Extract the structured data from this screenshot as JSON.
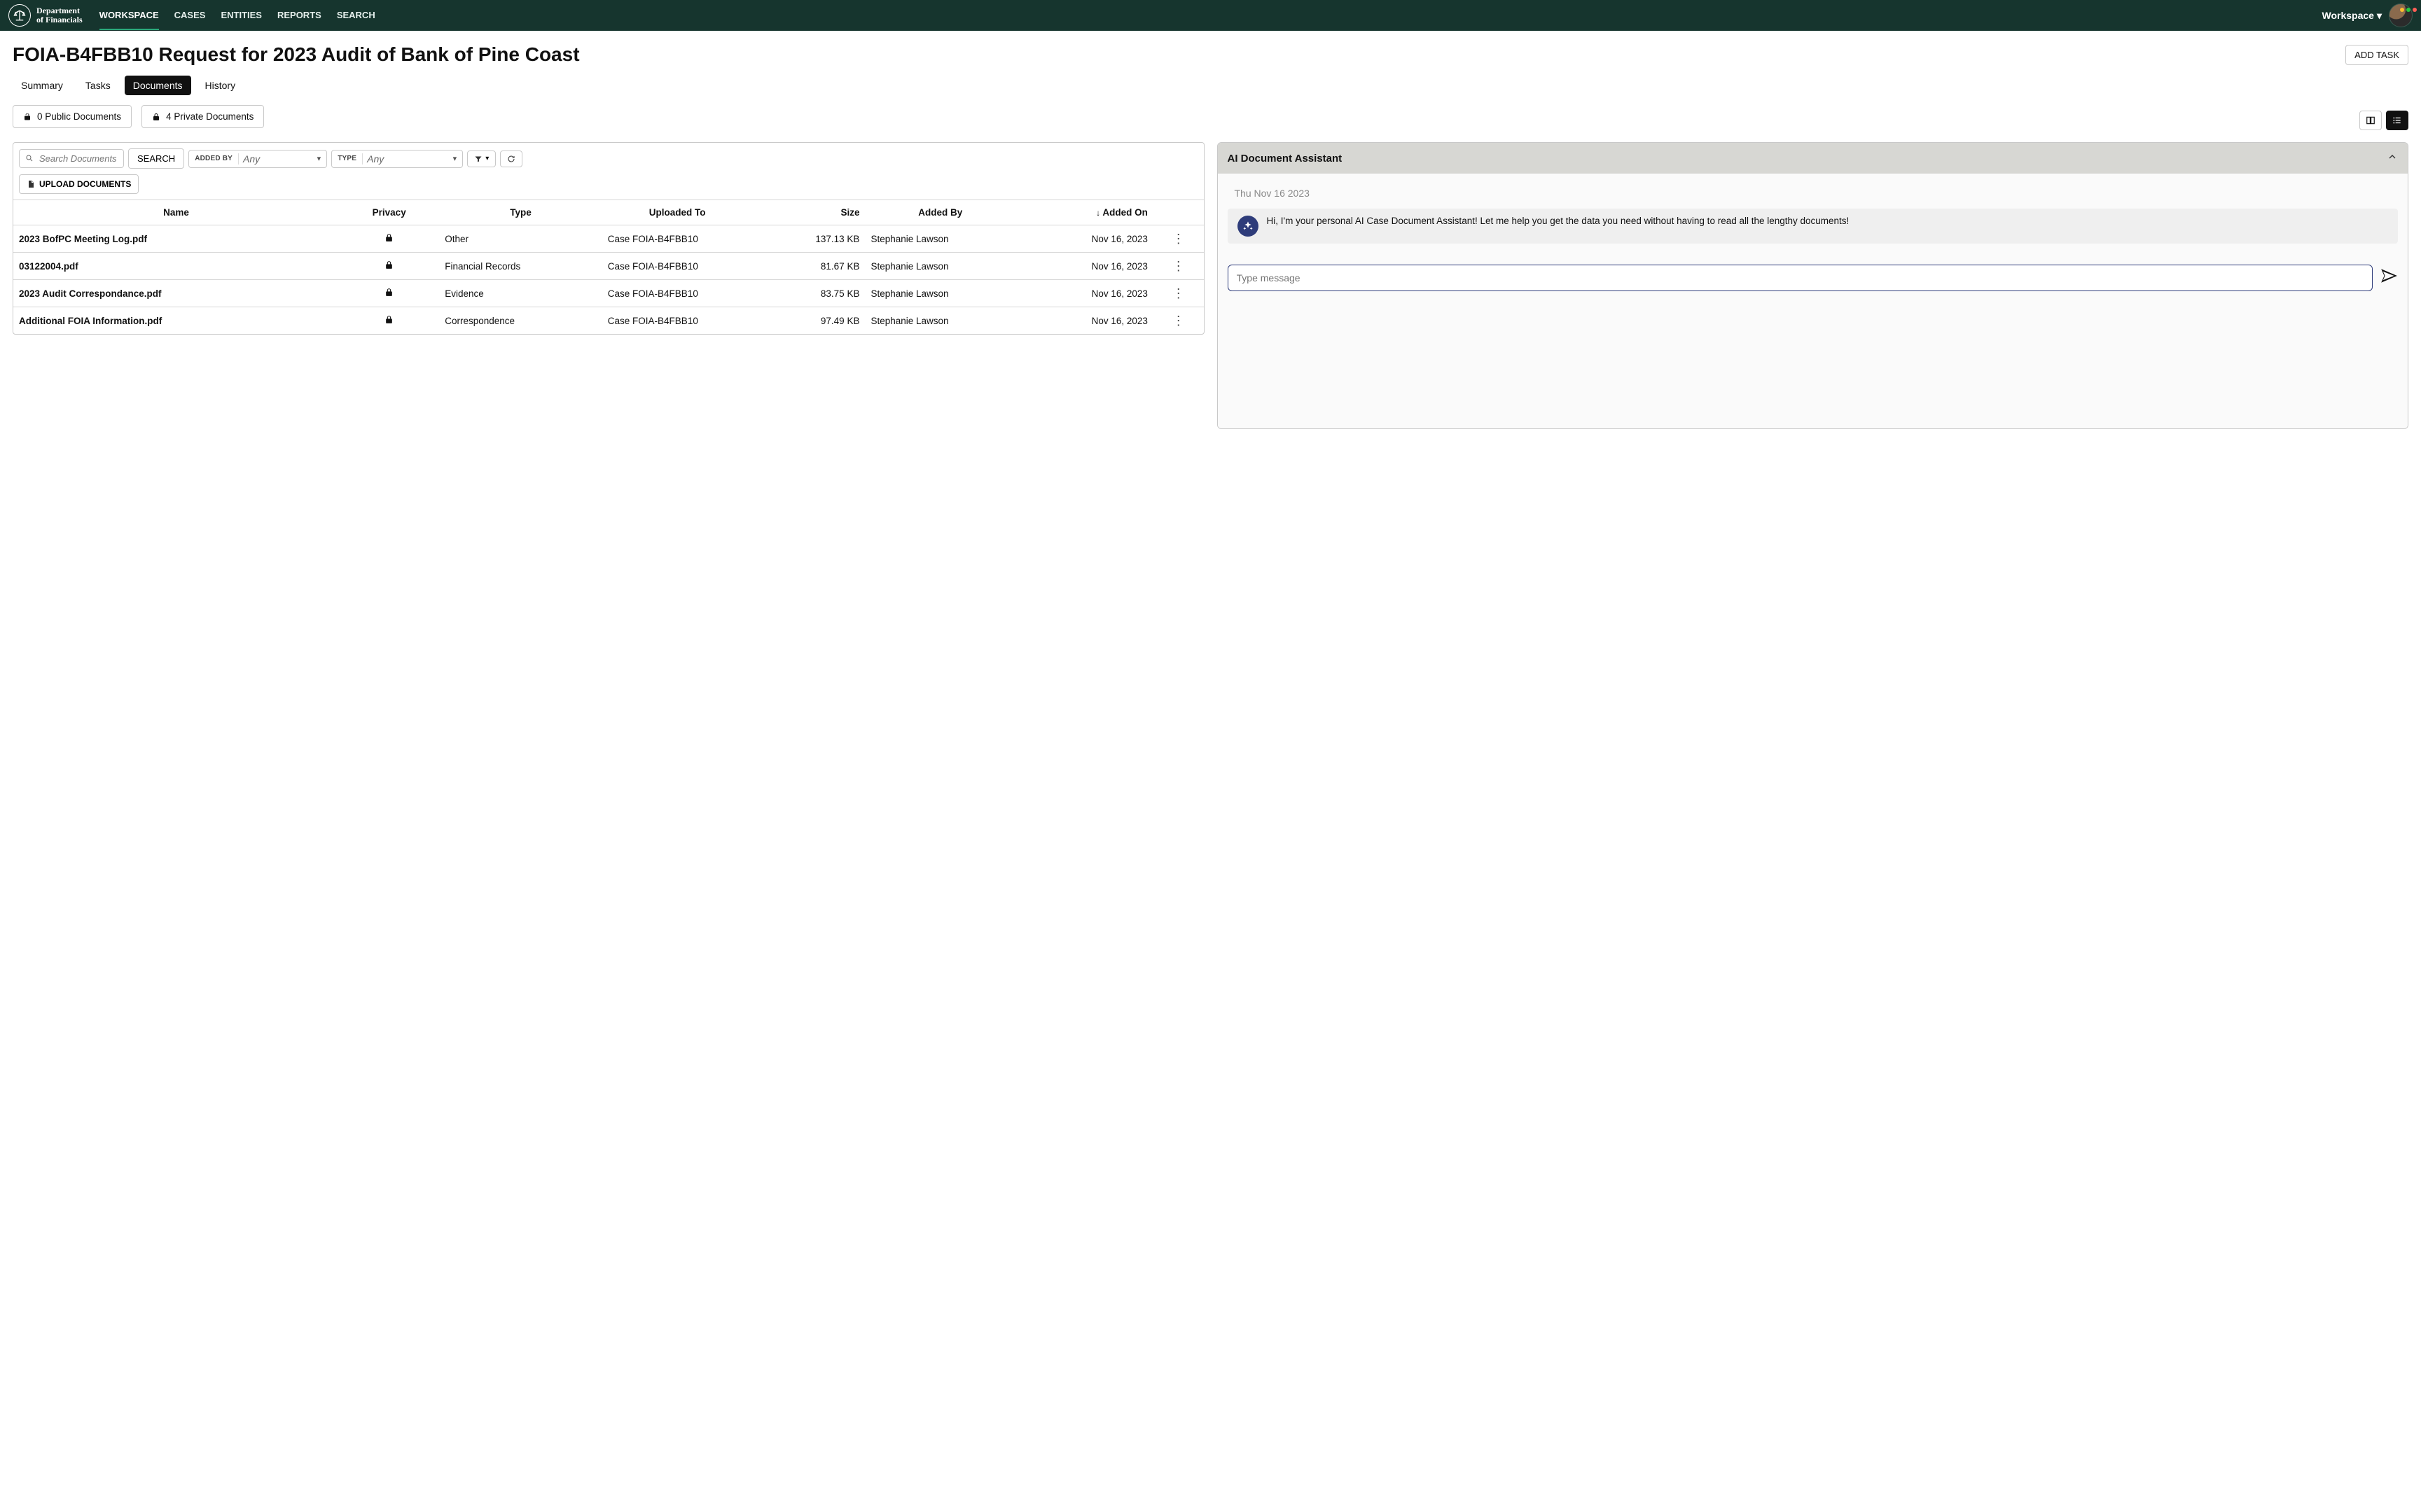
{
  "brand": {
    "line1": "Department",
    "line2": "of Financials"
  },
  "nav": {
    "items": [
      {
        "label": "WORKSPACE",
        "active": true
      },
      {
        "label": "CASES"
      },
      {
        "label": "ENTITIES"
      },
      {
        "label": "REPORTS"
      },
      {
        "label": "SEARCH"
      }
    ],
    "workspace_menu": "Workspace"
  },
  "page": {
    "title": "FOIA-B4FBB10 Request for 2023 Audit of Bank of Pine Coast",
    "add_task_label": "ADD TASK"
  },
  "tabs": [
    {
      "label": "Summary"
    },
    {
      "label": "Tasks"
    },
    {
      "label": "Documents",
      "active": true
    },
    {
      "label": "History"
    }
  ],
  "doc_counts": {
    "public": "0 Public Documents",
    "private": "4 Private Documents"
  },
  "toolbar": {
    "search_placeholder": "Search Documents",
    "search_button": "SEARCH",
    "added_by_label": "ADDED BY",
    "added_by_value": "Any",
    "type_label": "TYPE",
    "type_value": "Any",
    "upload_label": "UPLOAD DOCUMENTS"
  },
  "table": {
    "headers": {
      "name": "Name",
      "privacy": "Privacy",
      "type": "Type",
      "uploaded_to": "Uploaded To",
      "size": "Size",
      "added_by": "Added By",
      "added_on": "Added On"
    },
    "sort_icon": "↓",
    "rows": [
      {
        "name": "2023 BofPC Meeting Log.pdf",
        "privacy": "locked",
        "type": "Other",
        "uploaded_to": "Case FOIA-B4FBB10",
        "size": "137.13 KB",
        "added_by": "Stephanie Lawson",
        "added_on": "Nov 16, 2023"
      },
      {
        "name": "03122004.pdf",
        "privacy": "locked",
        "type": "Financial Records",
        "uploaded_to": "Case FOIA-B4FBB10",
        "size": "81.67 KB",
        "added_by": "Stephanie Lawson",
        "added_on": "Nov 16, 2023"
      },
      {
        "name": "2023 Audit Correspondance.pdf",
        "privacy": "locked",
        "type": "Evidence",
        "uploaded_to": "Case FOIA-B4FBB10",
        "size": "83.75 KB",
        "added_by": "Stephanie Lawson",
        "added_on": "Nov 16, 2023"
      },
      {
        "name": "Additional FOIA Information.pdf",
        "privacy": "locked",
        "type": "Correspondence",
        "uploaded_to": "Case FOIA-B4FBB10",
        "size": "97.49 KB",
        "added_by": "Stephanie Lawson",
        "added_on": "Nov 16, 2023"
      }
    ]
  },
  "assistant": {
    "header": "AI Document Assistant",
    "date": "Thu Nov 16 2023",
    "message": "Hi, I'm your personal AI Case Document Assistant! Let me help you get the data you need without having to read all the lengthy documents!",
    "input_placeholder": "Type message"
  }
}
